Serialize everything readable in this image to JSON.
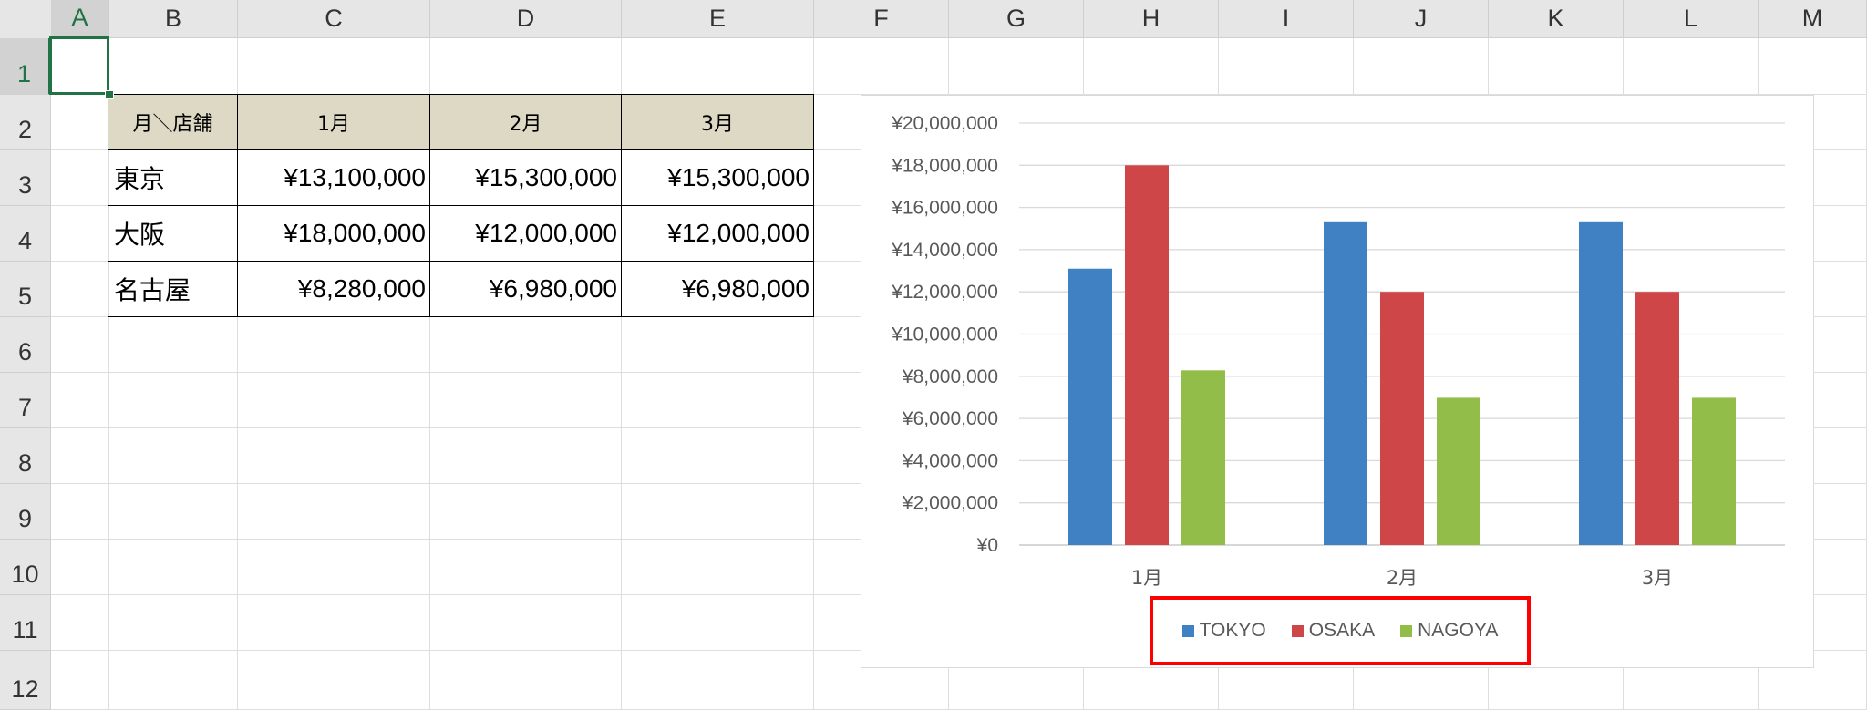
{
  "sheet": {
    "columns": [
      "A",
      "B",
      "C",
      "D",
      "E",
      "F",
      "G",
      "H",
      "I",
      "J",
      "K",
      "L",
      "M"
    ],
    "rows": [
      "1",
      "2",
      "3",
      "4",
      "5",
      "6",
      "7",
      "8",
      "9",
      "10",
      "11",
      "12"
    ],
    "active_column": "A",
    "active_row": "1"
  },
  "table": {
    "header": [
      "月＼店舗",
      "1月",
      "2月",
      "3月"
    ],
    "rows": [
      {
        "name": "東京",
        "values": [
          "¥13,100,000",
          "¥15,300,000",
          "¥15,300,000"
        ]
      },
      {
        "name": "大阪",
        "values": [
          "¥18,000,000",
          "¥12,000,000",
          "¥12,000,000"
        ]
      },
      {
        "name": "名古屋",
        "values": [
          "¥8,280,000",
          "¥6,980,000",
          "¥6,980,000"
        ]
      }
    ],
    "header_color": "#ddd9c4"
  },
  "chart_data": {
    "type": "bar",
    "categories": [
      "1月",
      "2月",
      "3月"
    ],
    "series": [
      {
        "name": "TOKYO",
        "color": "#3f81c2",
        "values": [
          13100000,
          15300000,
          15300000
        ]
      },
      {
        "name": "OSAKA",
        "color": "#cf4649",
        "values": [
          18000000,
          12000000,
          12000000
        ]
      },
      {
        "name": "NAGOYA",
        "color": "#92bd48",
        "values": [
          8280000,
          6980000,
          6980000
        ]
      }
    ],
    "ylim": [
      0,
      20000000
    ],
    "yticks": [
      "¥0",
      "¥2,000,000",
      "¥4,000,000",
      "¥6,000,000",
      "¥8,000,000",
      "¥10,000,000",
      "¥12,000,000",
      "¥14,000,000",
      "¥16,000,000",
      "¥18,000,000",
      "¥20,000,000"
    ],
    "grid": true,
    "legend_position": "bottom",
    "legend_highlight_color": "#ff0000",
    "title": "",
    "xlabel": "",
    "ylabel": ""
  }
}
